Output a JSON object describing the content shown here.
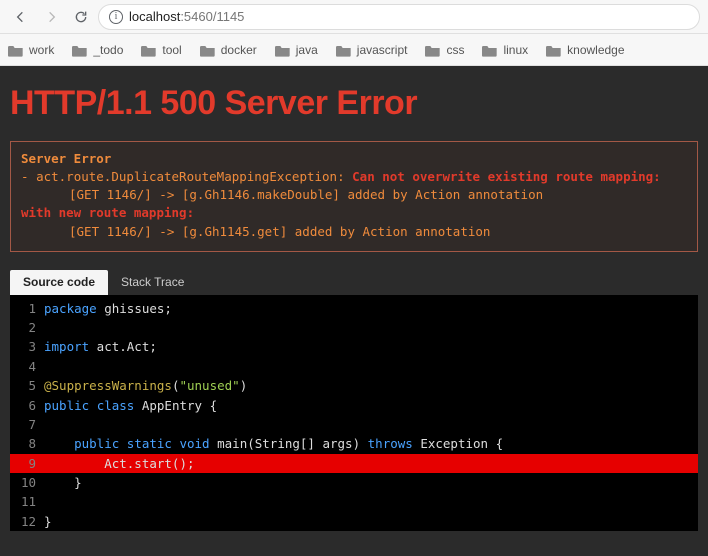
{
  "browser": {
    "url_host": "localhost",
    "url_port_path": ":5460/1145",
    "bookmarks": [
      "work",
      "_todo",
      "tool",
      "docker",
      "java",
      "javascript",
      "css",
      "linux",
      "knowledge"
    ]
  },
  "error": {
    "title": "HTTP/1.1 500 Server Error",
    "header": "Server Error",
    "prefix": " - ",
    "exception": "act.route.DuplicateRouteMappingException: ",
    "msg1": "Can not overwrite existing route mapping:",
    "route1": "[GET 1146/] -> [g.Gh1146.makeDouble] added by Action annotation",
    "msg2": "with new route mapping:",
    "route2": "[GET 1146/] -> [g.Gh1145.get] added by Action annotation"
  },
  "tabs": {
    "source": "Source code",
    "stack": "Stack Trace"
  },
  "code": {
    "highlight_line": 9,
    "lines": [
      {
        "n": 1,
        "tokens": [
          {
            "c": "kw",
            "t": "package"
          },
          {
            "c": "plain",
            "t": " ghissues;"
          }
        ]
      },
      {
        "n": 2,
        "tokens": []
      },
      {
        "n": 3,
        "tokens": [
          {
            "c": "kw",
            "t": "import"
          },
          {
            "c": "plain",
            "t": " act.Act;"
          }
        ]
      },
      {
        "n": 4,
        "tokens": []
      },
      {
        "n": 5,
        "tokens": [
          {
            "c": "ann",
            "t": "@SuppressWarnings"
          },
          {
            "c": "plain",
            "t": "("
          },
          {
            "c": "str",
            "t": "\"unused\""
          },
          {
            "c": "plain",
            "t": ")"
          }
        ]
      },
      {
        "n": 6,
        "tokens": [
          {
            "c": "kw",
            "t": "public"
          },
          {
            "c": "plain",
            "t": " "
          },
          {
            "c": "kw",
            "t": "class"
          },
          {
            "c": "plain",
            "t": " AppEntry {"
          }
        ]
      },
      {
        "n": 7,
        "tokens": []
      },
      {
        "n": 8,
        "tokens": [
          {
            "c": "plain",
            "t": "    "
          },
          {
            "c": "kw",
            "t": "public"
          },
          {
            "c": "plain",
            "t": " "
          },
          {
            "c": "kw",
            "t": "static"
          },
          {
            "c": "plain",
            "t": " "
          },
          {
            "c": "kw",
            "t": "void"
          },
          {
            "c": "plain",
            "t": " main(String[] args) "
          },
          {
            "c": "kw",
            "t": "throws"
          },
          {
            "c": "plain",
            "t": " Exception {"
          }
        ]
      },
      {
        "n": 9,
        "tokens": [
          {
            "c": "plain",
            "t": "        Act.start();"
          }
        ]
      },
      {
        "n": 10,
        "tokens": [
          {
            "c": "plain",
            "t": "    }"
          }
        ]
      },
      {
        "n": 11,
        "tokens": []
      },
      {
        "n": 12,
        "tokens": [
          {
            "c": "plain",
            "t": "}"
          }
        ]
      }
    ]
  }
}
